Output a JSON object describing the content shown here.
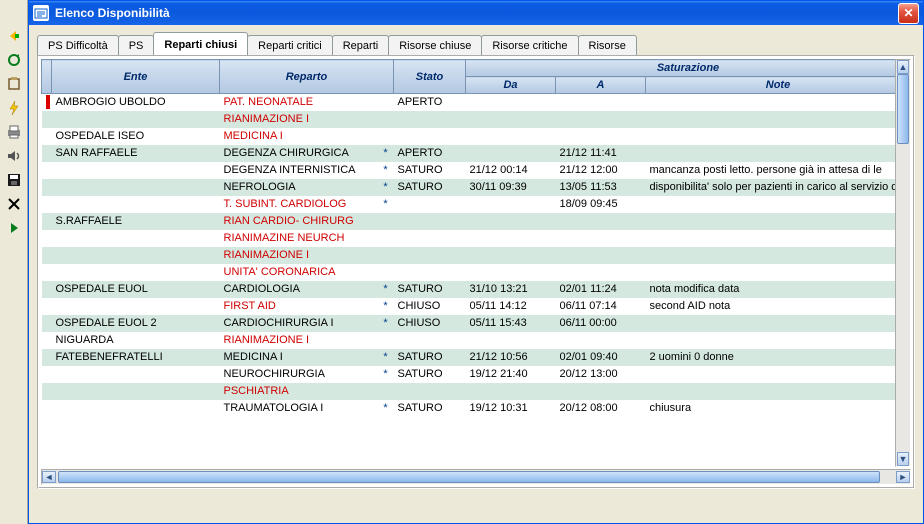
{
  "window": {
    "title": "Elenco Disponibilità"
  },
  "tabs": [
    {
      "label": "PS Difficoltà"
    },
    {
      "label": "PS"
    },
    {
      "label": "Reparti chiusi",
      "active": true
    },
    {
      "label": "Reparti critici"
    },
    {
      "label": "Reparti"
    },
    {
      "label": "Risorse chiuse"
    },
    {
      "label": "Risorse critiche"
    },
    {
      "label": "Risorse"
    }
  ],
  "headers": {
    "ente": "Ente",
    "reparto": "Reparto",
    "stato": "Stato",
    "saturazione": "Saturazione",
    "da": "Da",
    "a": "A",
    "note": "Note"
  },
  "rows": [
    {
      "mark": true,
      "ente": "AMBROGIO UBOLDO",
      "reparto": "PAT. NEONATALE",
      "red": true,
      "star": "",
      "stato": "APERTO",
      "da": "",
      "a": "",
      "note": ""
    },
    {
      "mark": false,
      "ente": "",
      "reparto": "RIANIMAZIONE I",
      "red": true,
      "star": "",
      "stato": "",
      "da": "",
      "a": "",
      "note": ""
    },
    {
      "mark": false,
      "ente": "OSPEDALE  ISEO",
      "reparto": "MEDICINA I",
      "red": true,
      "star": "",
      "stato": "",
      "da": "",
      "a": "",
      "note": ""
    },
    {
      "mark": false,
      "ente": "SAN RAFFAELE",
      "reparto": "DEGENZA CHIRURGICA",
      "red": false,
      "star": "*",
      "stato": "APERTO",
      "da": "",
      "a": "21/12 11:41",
      "note": ""
    },
    {
      "mark": false,
      "ente": "",
      "reparto": "DEGENZA INTERNISTICA",
      "red": false,
      "star": "*",
      "stato": "SATURO",
      "da": "21/12 00:14",
      "a": "21/12 12:00",
      "note": "mancanza posti letto.   persone già in attesa di le"
    },
    {
      "mark": false,
      "ente": "",
      "reparto": "NEFROLOGIA",
      "red": false,
      "star": "*",
      "stato": "SATURO",
      "da": "30/11 09:39",
      "a": "13/05 11:53",
      "note": "disponibilita' solo per pazienti in carico al servizio di"
    },
    {
      "mark": false,
      "ente": "",
      "reparto": "T. SUBINT. CARDIOLOG",
      "red": true,
      "star": "*",
      "stato": "",
      "da": "",
      "a": "18/09 09:45",
      "note": ""
    },
    {
      "mark": false,
      "ente": "S.RAFFAELE",
      "reparto": "RIAN CARDIO- CHIRURG",
      "red": true,
      "star": "",
      "stato": "",
      "da": "",
      "a": "",
      "note": ""
    },
    {
      "mark": false,
      "ente": "",
      "reparto": "RIANIMAZINE NEURCH",
      "red": true,
      "star": "",
      "stato": "",
      "da": "",
      "a": "",
      "note": ""
    },
    {
      "mark": false,
      "ente": "",
      "reparto": "RIANIMAZIONE I",
      "red": true,
      "star": "",
      "stato": "",
      "da": "",
      "a": "",
      "note": ""
    },
    {
      "mark": false,
      "ente": "",
      "reparto": "UNITA' CORONARICA",
      "red": true,
      "star": "",
      "stato": "",
      "da": "",
      "a": "",
      "note": ""
    },
    {
      "mark": false,
      "ente": "OSPEDALE EUOL",
      "reparto": "CARDIOLOGIA",
      "red": false,
      "star": "*",
      "stato": "SATURO",
      "da": "31/10 13:21",
      "a": "02/01 11:24",
      "note": "nota modifica data"
    },
    {
      "mark": false,
      "ente": "",
      "reparto": "FIRST AID",
      "red": true,
      "star": "*",
      "stato": "CHIUSO",
      "da": "05/11 14:12",
      "a": "06/11 07:14",
      "note": "second AID nota"
    },
    {
      "mark": false,
      "ente": "OSPEDALE EUOL 2",
      "reparto": "CARDIOCHIRURGIA I",
      "red": false,
      "star": "*",
      "stato": "CHIUSO",
      "da": "05/11 15:43",
      "a": "06/11 00:00",
      "note": ""
    },
    {
      "mark": false,
      "ente": "NIGUARDA",
      "reparto": "RIANIMAZIONE I",
      "red": true,
      "star": "",
      "stato": "",
      "da": "",
      "a": "",
      "note": ""
    },
    {
      "mark": false,
      "ente": "FATEBENEFRATELLI",
      "reparto": "MEDICINA I",
      "red": false,
      "star": "*",
      "stato": "SATURO",
      "da": "21/12 10:56",
      "a": "02/01 09:40",
      "note": "2 uomini 0 donne"
    },
    {
      "mark": false,
      "ente": "",
      "reparto": "NEUROCHIRURGIA",
      "red": false,
      "star": "*",
      "stato": "SATURO",
      "da": "19/12 21:40",
      "a": "20/12 13:00",
      "note": ""
    },
    {
      "mark": false,
      "ente": "",
      "reparto": "PSCHIATRIA",
      "red": true,
      "star": "",
      "stato": "",
      "da": "",
      "a": "",
      "note": ""
    },
    {
      "mark": false,
      "ente": "",
      "reparto": "TRAUMATOLOGIA I",
      "red": false,
      "star": "*",
      "stato": "SATURO",
      "da": "19/12 10:31",
      "a": "20/12 08:00",
      "note": "chiusura"
    }
  ]
}
